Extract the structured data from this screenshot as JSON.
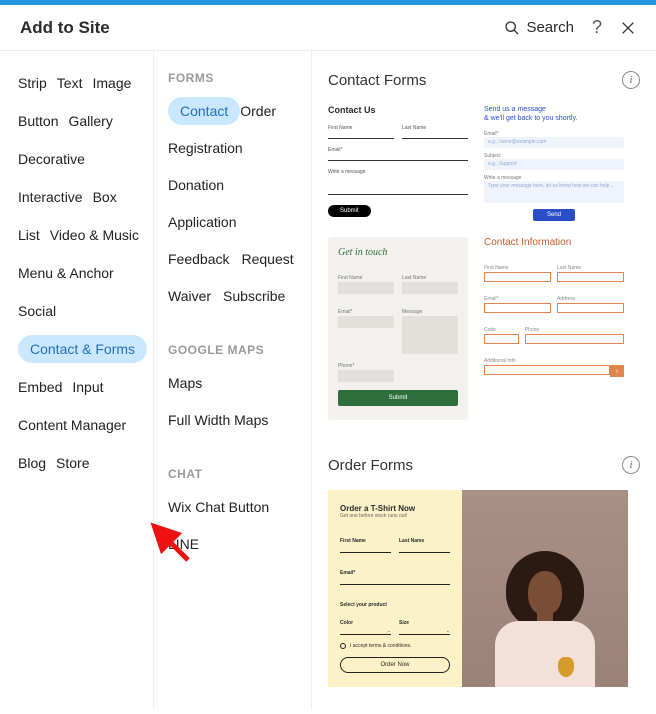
{
  "header": {
    "title": "Add to Site",
    "search_label": "Search",
    "help": "?",
    "close": "×"
  },
  "categories": [
    "Strip",
    "Text",
    "Image",
    "Button",
    "Gallery",
    "Decorative",
    "Interactive",
    "Box",
    "List",
    "Video & Music",
    "Menu & Anchor",
    "Social",
    "Contact & Forms",
    "Embed",
    "Input",
    "Content Manager",
    "Blog",
    "Store"
  ],
  "categories_selected": 12,
  "subpanel": {
    "groups": [
      {
        "heading": "FORMS",
        "items": [
          "Contact",
          "Order",
          "Registration",
          "Donation",
          "Application",
          "Feedback",
          "Request",
          "Waiver",
          "Subscribe"
        ],
        "selected": 0
      },
      {
        "heading": "GOOGLE MAPS",
        "items": [
          "Maps",
          "Full Width Maps"
        ],
        "selected": -1
      },
      {
        "heading": "CHAT",
        "items": [
          "Wix Chat Button",
          "LINE"
        ],
        "selected": -1
      }
    ]
  },
  "content": {
    "section1": {
      "title": "Contact Forms"
    },
    "section2": {
      "title": "Order Forms"
    },
    "preview1": {
      "title": "Contact Us",
      "first": "First Name",
      "last": "Last Name",
      "email": "Email*",
      "msg": "Write a message",
      "submit": "Submit"
    },
    "preview2": {
      "line1": "Send us a message",
      "line2": "& we'll get back to you shortly.",
      "email_lbl": "Email*",
      "email_ph": "e.g., name@example.com",
      "subj_lbl": "Subject",
      "subj_ph": "e.g., Support",
      "msg_lbl": "Write a message",
      "msg_ph": "Type your message here, let us know how we can help...",
      "send": "Send"
    },
    "preview3": {
      "title": "Get in touch",
      "first": "First Name",
      "last": "Last Name",
      "email": "Email*",
      "msg": "Message",
      "phone": "Phone*",
      "submit": "Submit"
    },
    "preview4": {
      "title": "Contact Information",
      "first": "First Name",
      "last": "Last Name",
      "email": "Email*",
      "addr": "Address",
      "code": "Code",
      "phone": "Phone",
      "addl": "Additional Info",
      "go": "›"
    },
    "order": {
      "title": "Order a T-Shirt Now",
      "sub": "Get one before stock runs out!",
      "first": "First Name",
      "last": "Last Name",
      "email": "Email*",
      "select": "Select your product",
      "color": "Color",
      "size": "Size",
      "terms": "I accept terms & conditions.",
      "btn": "Order Now"
    }
  }
}
